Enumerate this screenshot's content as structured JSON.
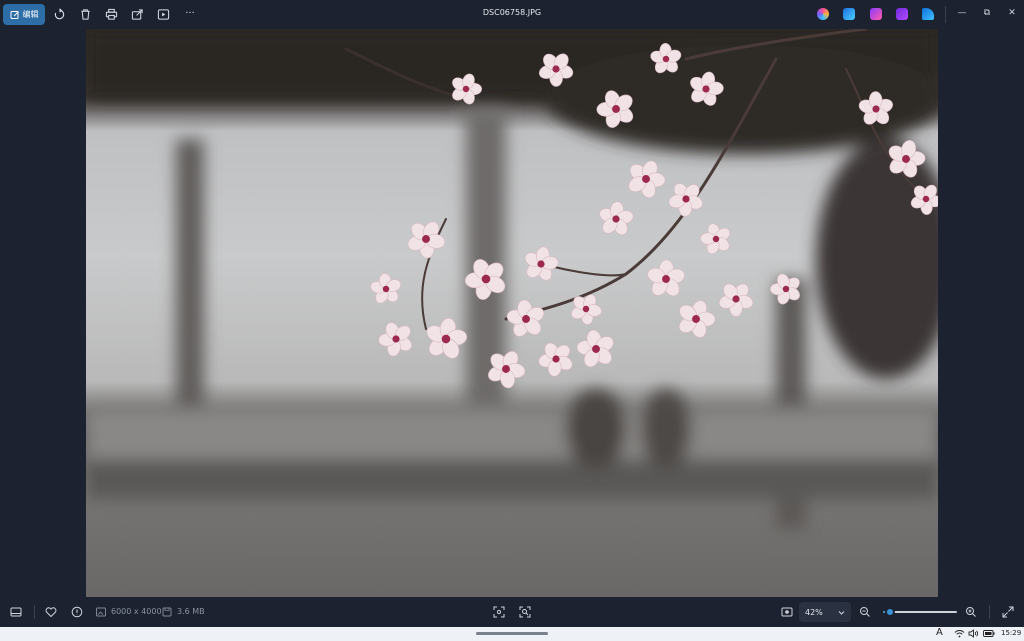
{
  "toolbar": {
    "edit_label": "编辑",
    "file_name": "DSC06758.JPG",
    "more_label": "···"
  },
  "window_controls": {
    "minimize": "—",
    "restore": "⧉",
    "close": "✕"
  },
  "status": {
    "dimensions": "6000 x 4000",
    "file_size": "3.6 MB"
  },
  "zoom": {
    "value": "42%",
    "fraction": 0.1
  },
  "taskbar": {
    "ime": "A",
    "time": "15:29"
  },
  "colors": {
    "accent": "#2c6ea5",
    "slider": "#3a93d6",
    "background": "#1c2230"
  }
}
